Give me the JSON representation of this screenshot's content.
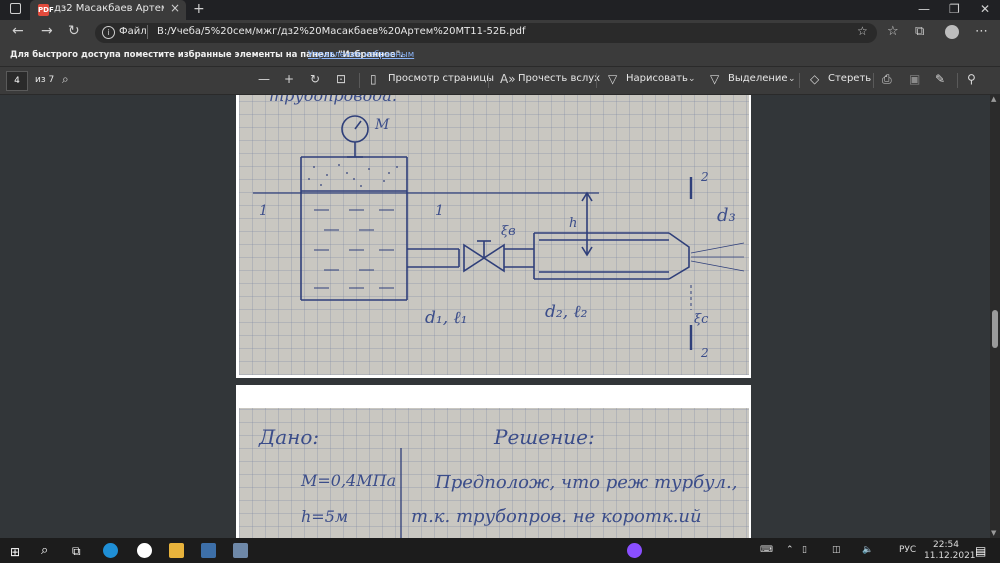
{
  "browser": {
    "tab_title": "дз2 Масакбаев Артем МТ11-52Б",
    "tab_close": "×",
    "new_tab": "+",
    "window_controls": [
      "—",
      "❐",
      "✕"
    ],
    "address": {
      "scheme_label": "Файл",
      "url": "B:/Учеба/5%20сем/мжг/дз2%20Масакбаев%20Артем%20МТ11-52Б.pdf"
    },
    "favorites_bar": {
      "message": "Для быстрого доступа поместите избранные элементы на панель \"Избранное\".",
      "link": "Управление избранным"
    }
  },
  "pdf_toolbar": {
    "page_number": "4",
    "page_count": "из 7",
    "zoom_out": "—",
    "zoom_in": "+",
    "page_view": "Просмотр страницы",
    "read_aloud": "Прочесть вслух",
    "draw": "Нарисовать",
    "highlight": "Выделение",
    "erase": "Стереть"
  },
  "sketch": {
    "labels": {
      "title_partial": "трубопровода.",
      "gauge": "М",
      "section_1": "1",
      "section_2": "2",
      "d3": "d₃",
      "h": "h",
      "v_valve": "ξв",
      "pipe1": "d₁, ℓ₁",
      "pipe2": "d₂, ℓ₂",
      "v_nozzle": "ξс"
    }
  },
  "notes": {
    "given_header": "Дано:",
    "solution_header": "Решение:",
    "given_M": "М=0,4МПа",
    "given_h": "h=5м",
    "solution_line1": "Предполож, что реж турбул.,",
    "solution_line2": "т.к. трубопров. не коротк.ий"
  },
  "taskbar": {
    "lang": "РУС",
    "time": "22:54",
    "date": "11.12.2021"
  }
}
